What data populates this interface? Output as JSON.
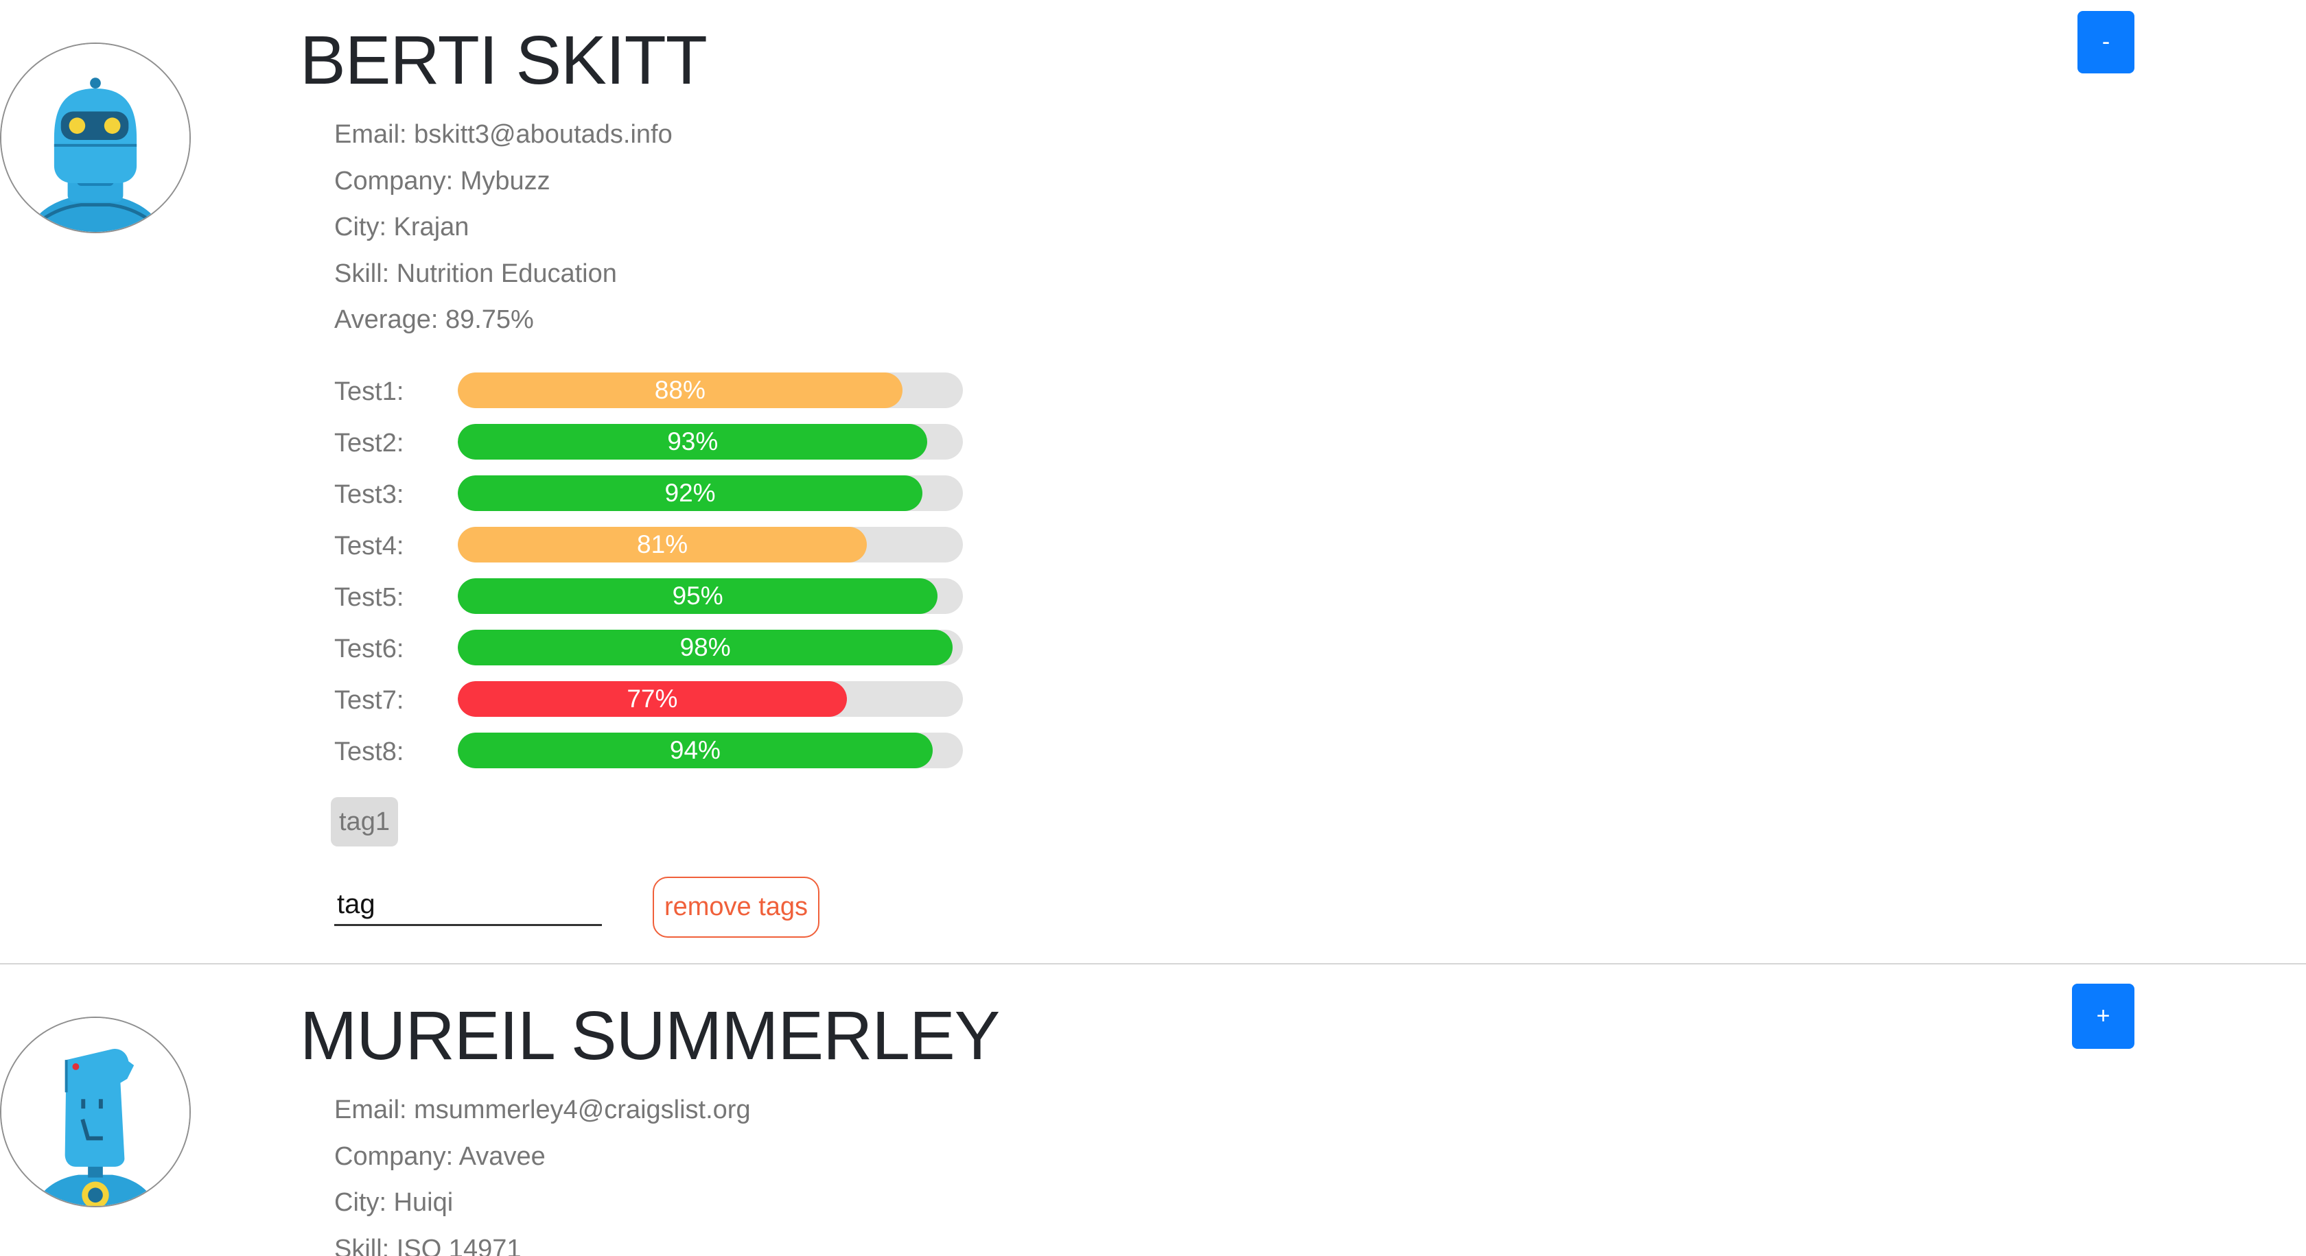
{
  "students": [
    {
      "name": "BERTI SKITT",
      "avatar_icon": "robot-avatar-icon",
      "toggle_label": "-",
      "expanded": true,
      "info": {
        "email": "Email: bskitt3@aboutads.info",
        "company": "Company: Mybuzz",
        "city": "City: Krajan",
        "skill": "Skill: Nutrition Education",
        "average": "Average: 89.75%"
      },
      "tests": [
        {
          "label": "Test1:",
          "value_text": "88%",
          "value": 88,
          "color": "#fdba5a"
        },
        {
          "label": "Test2:",
          "value_text": "93%",
          "value": 93,
          "color": "#1fc22f"
        },
        {
          "label": "Test3:",
          "value_text": "92%",
          "value": 92,
          "color": "#1fc22f"
        },
        {
          "label": "Test4:",
          "value_text": "81%",
          "value": 81,
          "color": "#fdba5a"
        },
        {
          "label": "Test5:",
          "value_text": "95%",
          "value": 95,
          "color": "#1fc22f"
        },
        {
          "label": "Test6:",
          "value_text": "98%",
          "value": 98,
          "color": "#1fc22f"
        },
        {
          "label": "Test7:",
          "value_text": "77%",
          "value": 77,
          "color": "#fb3440"
        },
        {
          "label": "Test8:",
          "value_text": "94%",
          "value": 94,
          "color": "#1fc22f"
        }
      ],
      "tags": [
        "tag1"
      ],
      "tag_input_value": "tag",
      "remove_tags_label": "remove tags"
    },
    {
      "name": "MUREIL SUMMERLEY",
      "avatar_icon": "robot-avatar-icon",
      "toggle_label": "+",
      "expanded": false,
      "info": {
        "email": "Email: msummerley4@craigslist.org",
        "company": "Company: Avavee",
        "city": "City: Huiqi",
        "skill": "Skill: ISO 14971"
      }
    }
  ]
}
